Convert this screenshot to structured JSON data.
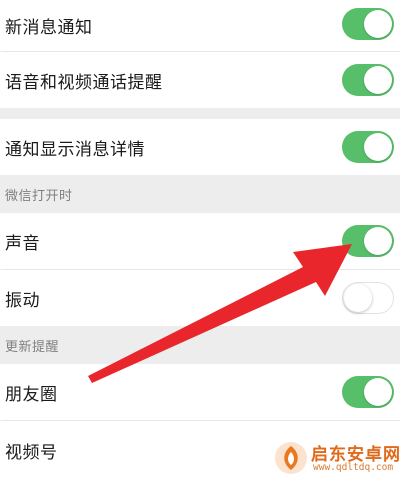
{
  "settings": {
    "new_message_notify": {
      "label": "新消息通知",
      "enabled": true
    },
    "voice_video_call_remind": {
      "label": "语音和视频通话提醒",
      "enabled": true
    },
    "show_message_details": {
      "label": "通知显示消息详情",
      "enabled": true
    },
    "section_when_open": {
      "header": "微信打开时"
    },
    "sound": {
      "label": "声音",
      "enabled": true
    },
    "vibrate": {
      "label": "振动",
      "enabled": false
    },
    "section_update_remind": {
      "header": "更新提醒"
    },
    "moments": {
      "label": "朋友圈",
      "enabled": true
    },
    "channels": {
      "label": "视频号"
    }
  },
  "annotation": {
    "color": "#e8262c"
  },
  "watermark": {
    "title": "启东安卓网",
    "url": "www.qdltdq.com"
  },
  "colors": {
    "toggle_on": "#57be6a",
    "background": "#ededed"
  }
}
